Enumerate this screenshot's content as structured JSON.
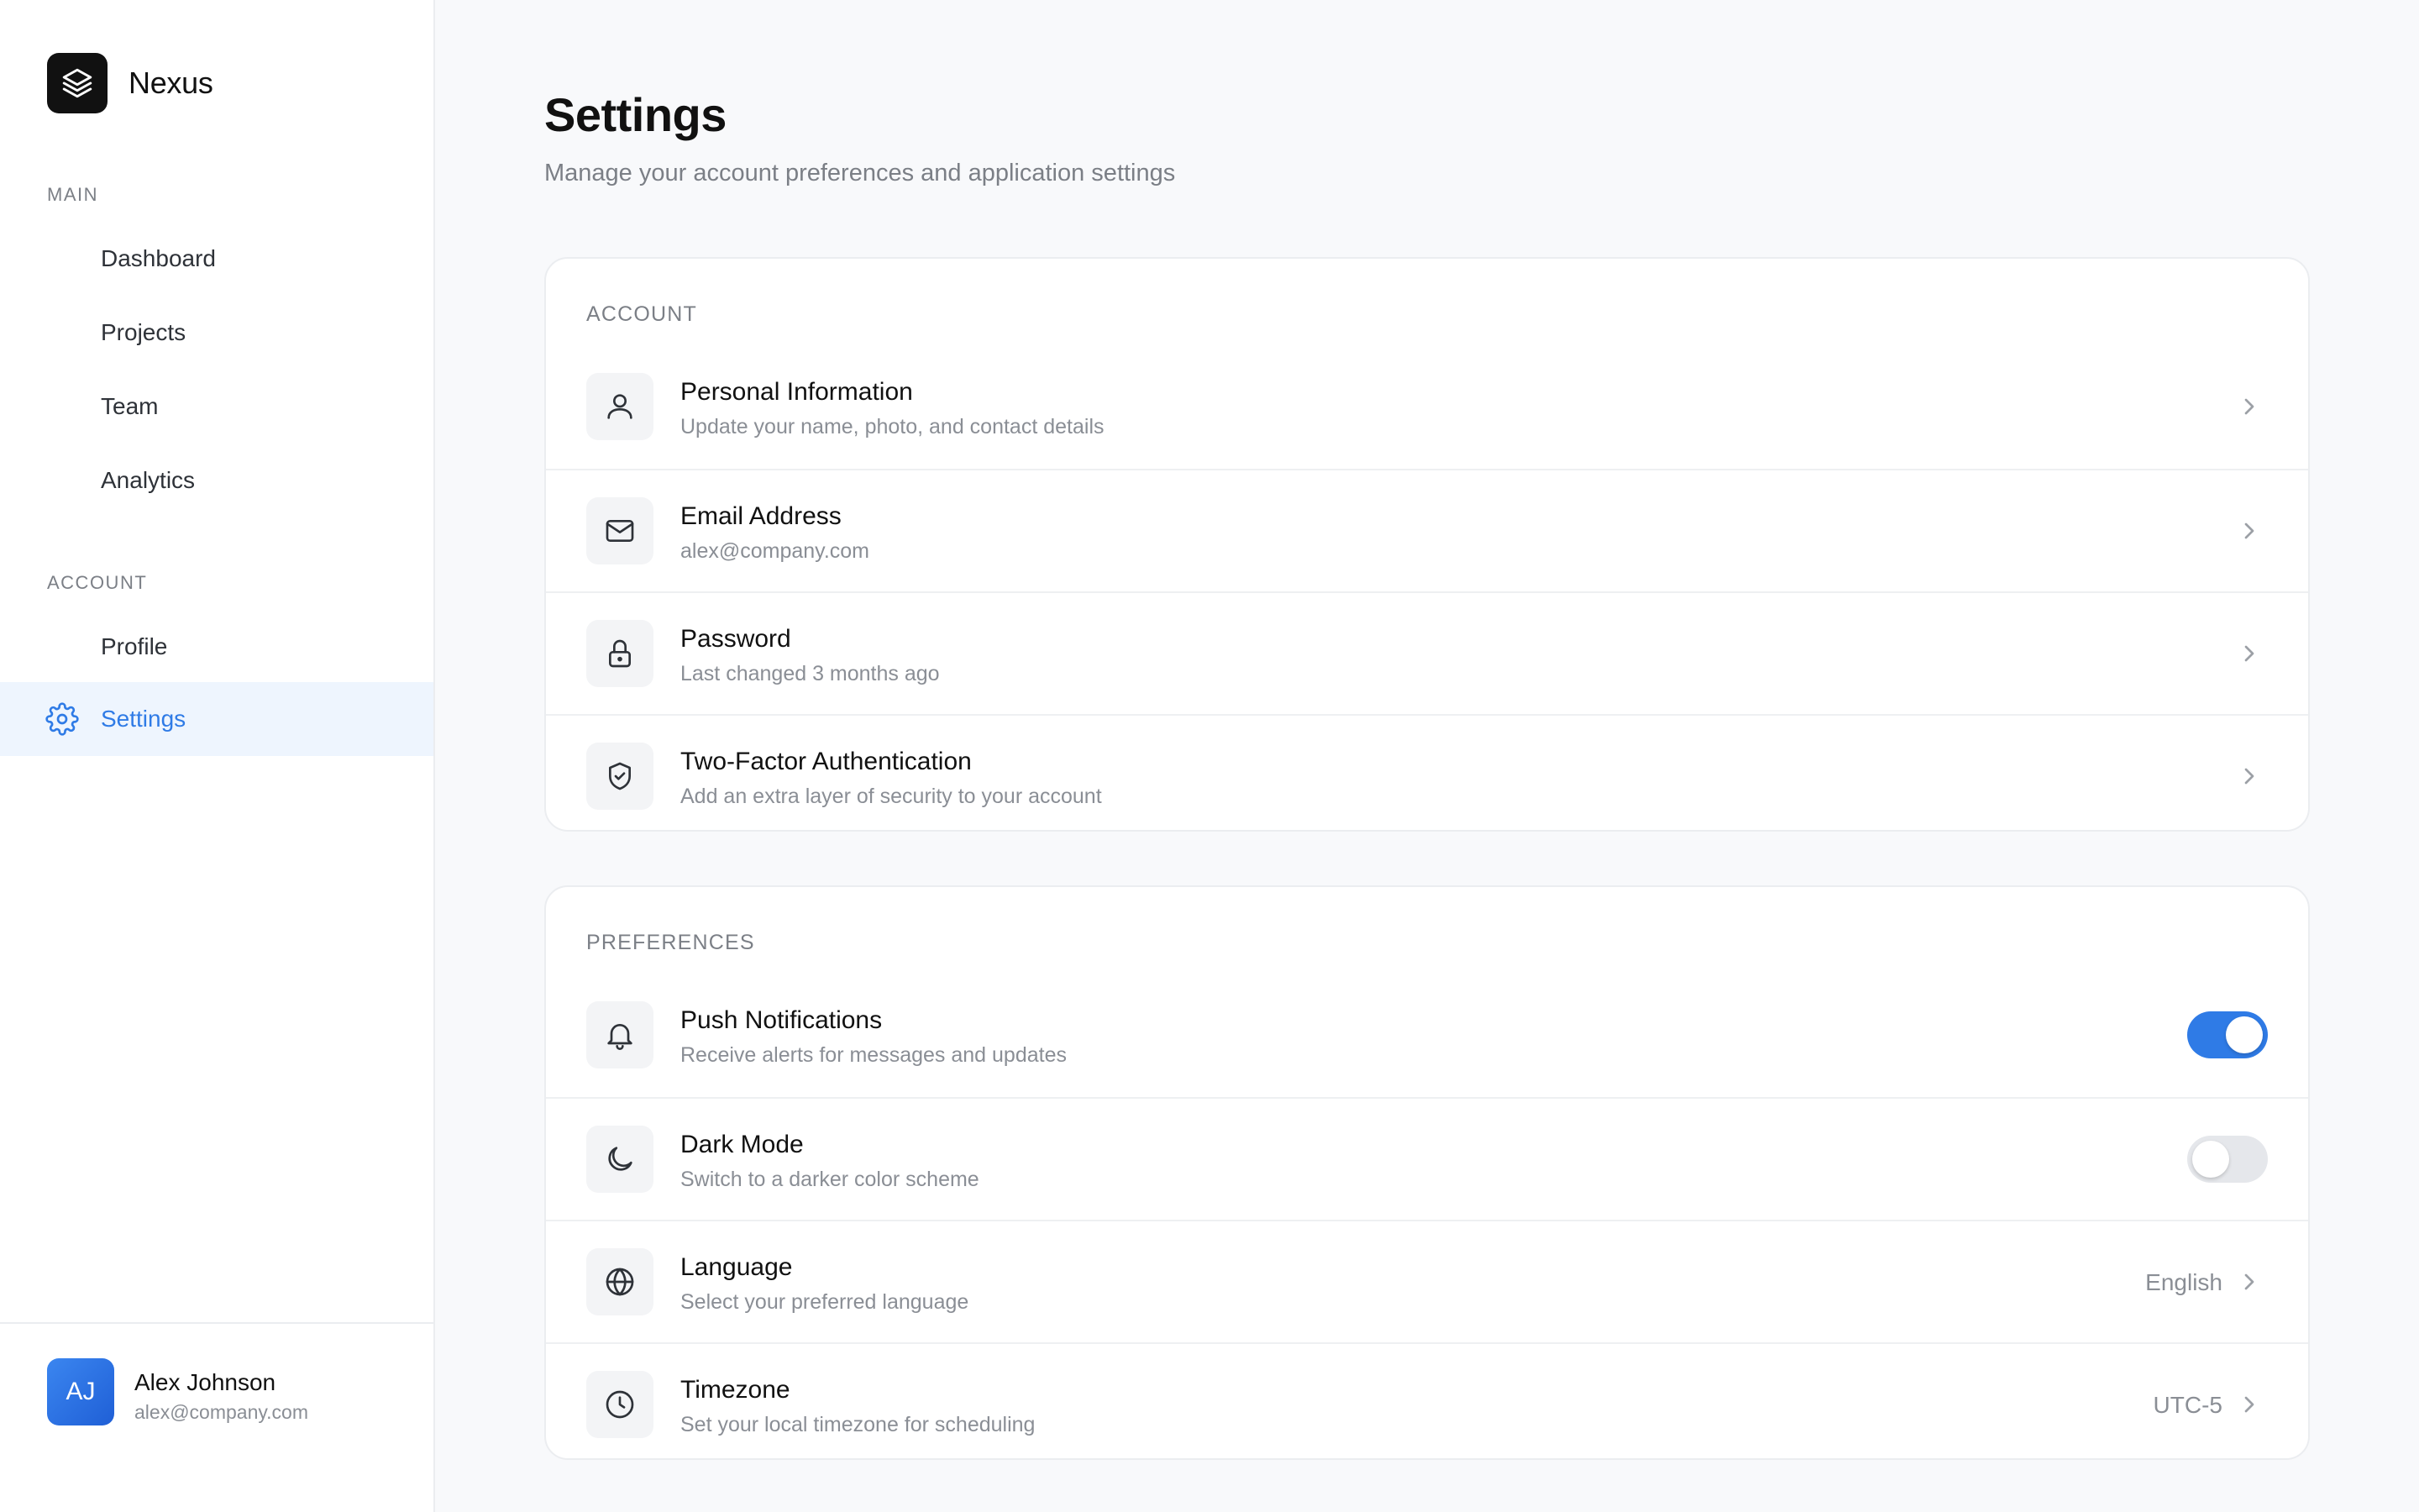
{
  "brand": {
    "name": "Nexus"
  },
  "sidebar": {
    "main_label": "MAIN",
    "main_items": [
      {
        "label": "Dashboard"
      },
      {
        "label": "Projects"
      },
      {
        "label": "Team"
      },
      {
        "label": "Analytics"
      }
    ],
    "account_label": "ACCOUNT",
    "account_items": [
      {
        "label": "Profile"
      },
      {
        "label": "Settings",
        "active": true,
        "icon": "gear-icon"
      }
    ]
  },
  "user": {
    "initials": "AJ",
    "name": "Alex Johnson",
    "email": "alex@company.com"
  },
  "page": {
    "title": "Settings",
    "subtitle": "Manage your account preferences and application settings"
  },
  "account_card": {
    "label": "ACCOUNT",
    "rows": [
      {
        "title": "Personal Information",
        "desc": "Update your name, photo, and contact details",
        "icon": "user-icon"
      },
      {
        "title": "Email Address",
        "desc": "alex@company.com",
        "icon": "mail-icon"
      },
      {
        "title": "Password",
        "desc": "Last changed 3 months ago",
        "icon": "lock-icon"
      },
      {
        "title": "Two-Factor Authentication",
        "desc": "Add an extra layer of security to your account",
        "icon": "shield-check-icon"
      }
    ]
  },
  "preferences_card": {
    "label": "PREFERENCES",
    "rows": [
      {
        "title": "Push Notifications",
        "desc": "Receive alerts for messages and updates",
        "icon": "bell-icon",
        "toggle": true
      },
      {
        "title": "Dark Mode",
        "desc": "Switch to a darker color scheme",
        "icon": "moon-icon",
        "toggle": false
      },
      {
        "title": "Language",
        "desc": "Select your preferred language",
        "icon": "globe-icon",
        "value": "English"
      },
      {
        "title": "Timezone",
        "desc": "Set your local timezone for scheduling",
        "icon": "clock-icon",
        "value": "UTC-5"
      }
    ]
  },
  "colors": {
    "accent": "#2f7be6",
    "active_bg": "#eef5fe",
    "toggle_off": "#e5e7eb"
  }
}
